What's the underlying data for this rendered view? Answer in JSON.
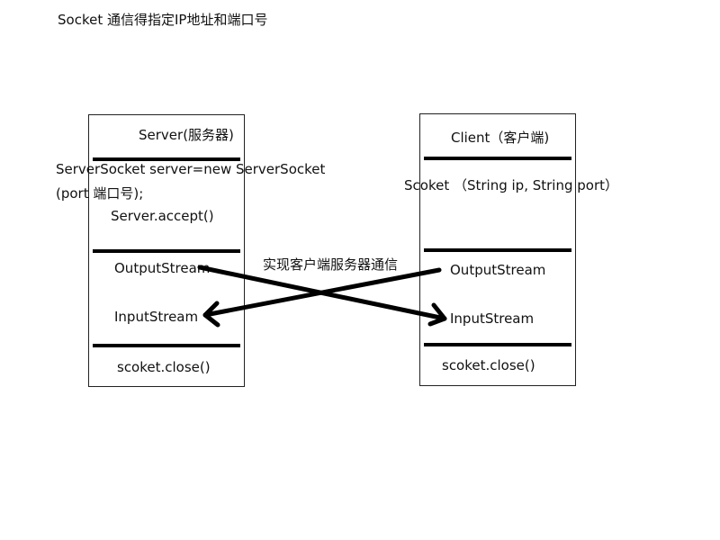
{
  "title": "Socket 通信得指定IP地址和端口号",
  "server": {
    "heading": "Server(服务器)",
    "code_line1": "ServerSocket server=new ServerSocket",
    "code_line2": "(port 端口号);",
    "accept": "Server.accept()",
    "output": "OutputStream",
    "input": "InputStream",
    "close": "scoket.close()"
  },
  "client": {
    "heading": "Client（客户端)",
    "socket": "Scoket  （String ip, String port）",
    "output": "OutputStream",
    "input": "InputStream",
    "close": "scoket.close()"
  },
  "connection_label": "实现客户端服务器通信",
  "colors": {
    "line": "#000000",
    "border": "#222222",
    "background": "#ffffff"
  }
}
